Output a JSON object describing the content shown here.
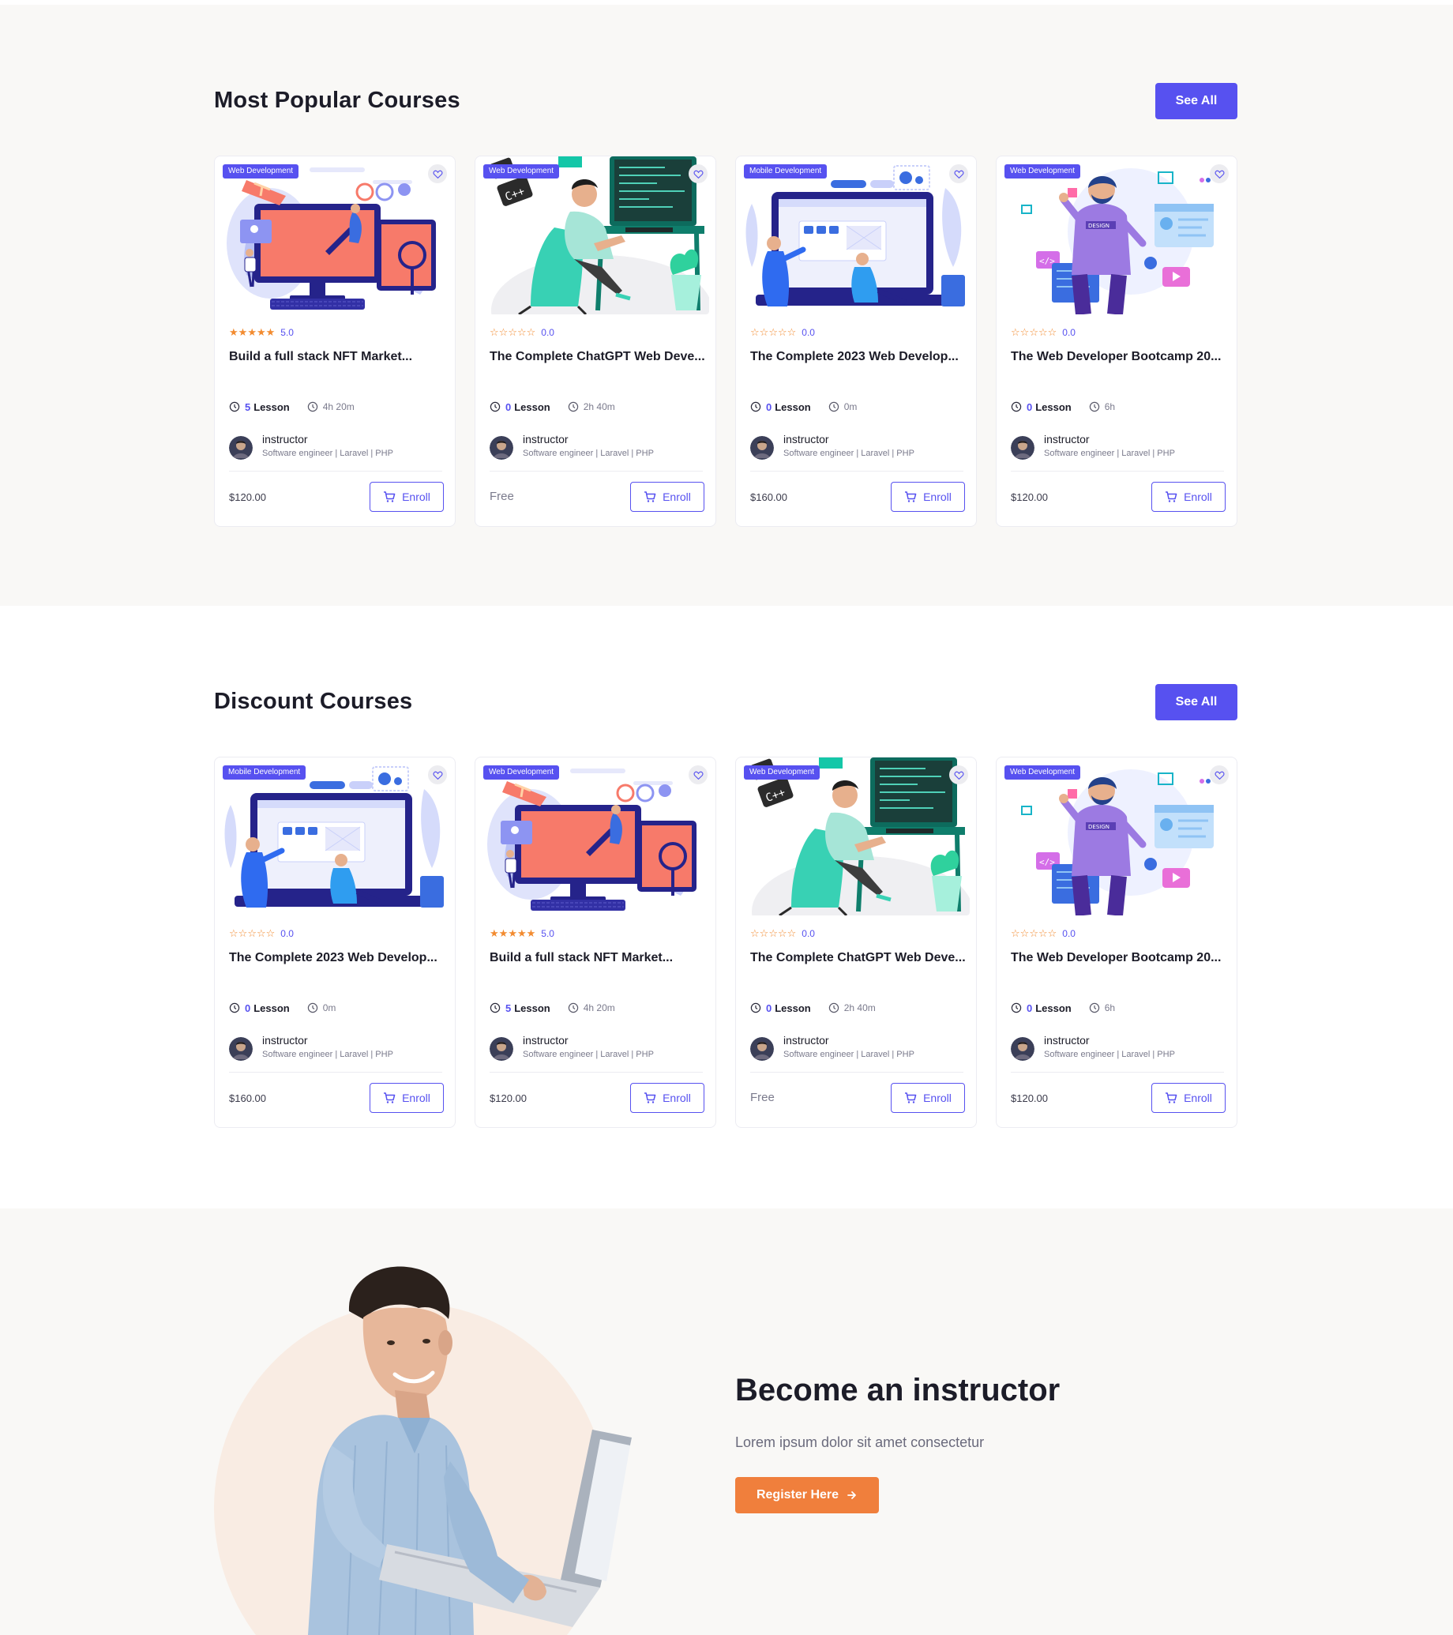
{
  "popular": {
    "title": "Most Popular Courses",
    "see_all": "See All",
    "courses": [
      {
        "category": "Web Development",
        "rating": "5.0",
        "stars_filled": 5,
        "title": "Build a full stack NFT Market...",
        "lessons": "5",
        "lesson_label": "Lesson",
        "duration": "4h 20m",
        "instructor": "instructor",
        "role": "Software engineer | Laravel | PHP",
        "price": "$120.00",
        "enroll": "Enroll",
        "image": "nft-monitor"
      },
      {
        "category": "Web Development",
        "rating": "0.0",
        "stars_filled": 0,
        "title": "The Complete ChatGPT Web Deve...",
        "lessons": "0",
        "lesson_label": "Lesson",
        "duration": "2h 40m",
        "instructor": "instructor",
        "role": "Software engineer | Laravel | PHP",
        "price": "Free",
        "enroll": "Enroll",
        "image": "coder-desk"
      },
      {
        "category": "Mobile Development",
        "rating": "0.0",
        "stars_filled": 0,
        "title": "The Complete 2023 Web Develop...",
        "lessons": "0",
        "lesson_label": "Lesson",
        "duration": "0m",
        "instructor": "instructor",
        "role": "Software engineer | Laravel | PHP",
        "price": "$160.00",
        "enroll": "Enroll",
        "image": "web-laptop"
      },
      {
        "category": "Web Development",
        "rating": "0.0",
        "stars_filled": 0,
        "title": "The Web Developer Bootcamp 20...",
        "lessons": "0",
        "lesson_label": "Lesson",
        "duration": "6h",
        "instructor": "instructor",
        "role": "Software engineer | Laravel | PHP",
        "price": "$120.00",
        "enroll": "Enroll",
        "image": "designer-man"
      }
    ]
  },
  "discount": {
    "title": "Discount Courses",
    "see_all": "See All",
    "courses": [
      {
        "category": "Mobile Development",
        "rating": "0.0",
        "stars_filled": 0,
        "title": "The Complete 2023 Web Develop...",
        "lessons": "0",
        "lesson_label": "Lesson",
        "duration": "0m",
        "instructor": "instructor",
        "role": "Software engineer | Laravel | PHP",
        "price": "$160.00",
        "enroll": "Enroll",
        "image": "web-laptop"
      },
      {
        "category": "Web Development",
        "rating": "5.0",
        "stars_filled": 5,
        "title": "Build a full stack NFT Market...",
        "lessons": "5",
        "lesson_label": "Lesson",
        "duration": "4h 20m",
        "instructor": "instructor",
        "role": "Software engineer | Laravel | PHP",
        "price": "$120.00",
        "enroll": "Enroll",
        "image": "nft-monitor"
      },
      {
        "category": "Web Development",
        "rating": "0.0",
        "stars_filled": 0,
        "title": "The Complete ChatGPT Web Deve...",
        "lessons": "0",
        "lesson_label": "Lesson",
        "duration": "2h 40m",
        "instructor": "instructor",
        "role": "Software engineer | Laravel | PHP",
        "price": "Free",
        "enroll": "Enroll",
        "image": "coder-desk"
      },
      {
        "category": "Web Development",
        "rating": "0.0",
        "stars_filled": 0,
        "title": "The Web Developer Bootcamp 20...",
        "lessons": "0",
        "lesson_label": "Lesson",
        "duration": "6h",
        "instructor": "instructor",
        "role": "Software engineer | Laravel | PHP",
        "price": "$120.00",
        "enroll": "Enroll",
        "image": "designer-man"
      }
    ]
  },
  "become_instructor": {
    "title": "Become an instructor",
    "subtitle": "Lorem ipsum dolor sit amet consectetur",
    "button": "Register Here"
  },
  "colors": {
    "accent": "#5751f0",
    "star": "#f28b30",
    "orange_button": "#f07f3c",
    "section_bg": "#f9f8f6"
  }
}
